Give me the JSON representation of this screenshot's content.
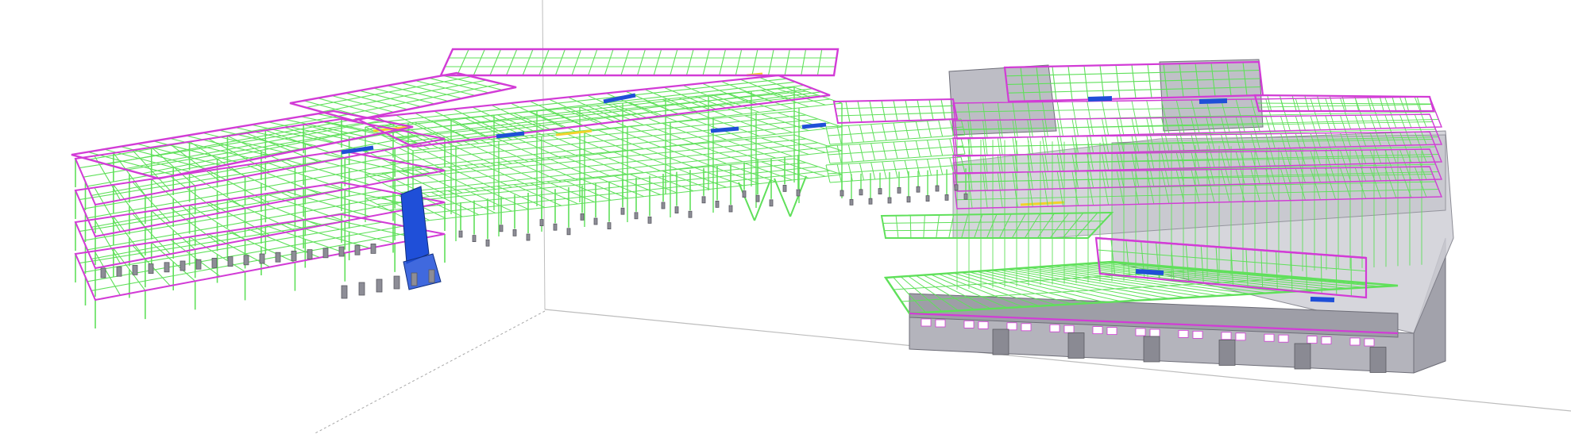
{
  "viewer": {
    "background": "#ffffff"
  },
  "palette": {
    "steel_green": "#5fe05a",
    "slab_magenta": "#d23bd6",
    "duct_blue": "#1f4fd8",
    "accent_yellow": "#f2d22a",
    "concrete_grey": "#9a9aa3",
    "concrete_dark": "#6e6e78",
    "ground_line": "#b9b9b9",
    "axis_dash": "#a8a8a8"
  },
  "model": {
    "components": [
      "structural-steel",
      "floor-slab-edges",
      "mep-ducts",
      "concrete-walls",
      "footings"
    ]
  }
}
